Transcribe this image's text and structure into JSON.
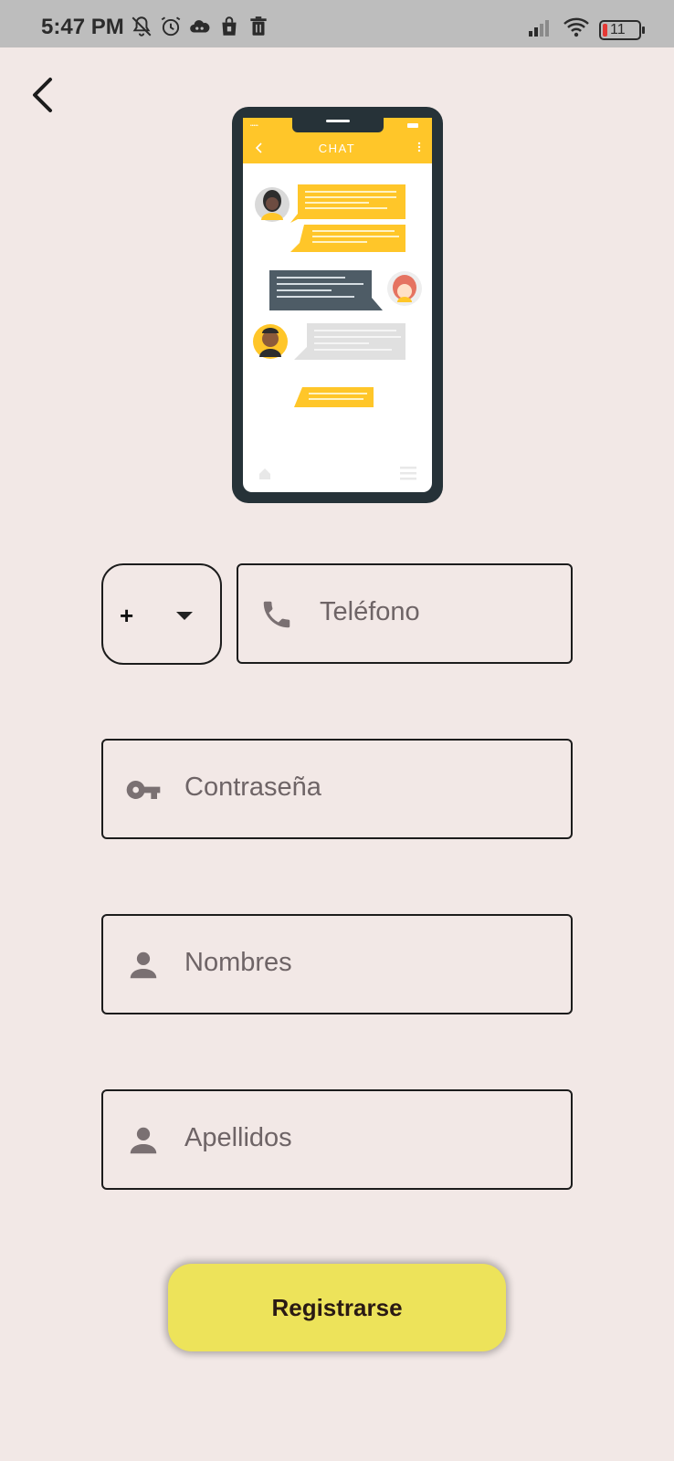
{
  "status_bar": {
    "time": "5:47 PM",
    "battery_level": "11",
    "icons_left": [
      "bell-off-icon",
      "alarm-icon",
      "cloud-icon",
      "shopping-bag-icon",
      "trash-icon"
    ],
    "icons_right": [
      "signal-icon",
      "wifi-icon",
      "battery-icon"
    ]
  },
  "nav": {
    "back_icon": "chevron-left-icon"
  },
  "illustration": {
    "header_title": "CHAT",
    "header_color": "#ffc629",
    "frame_color": "#263238"
  },
  "form": {
    "country_code": {
      "prefix": "+",
      "icon": "dropdown-arrow-icon"
    },
    "phone": {
      "placeholder": "Teléfono",
      "icon": "phone-icon"
    },
    "password": {
      "placeholder": "Contraseña",
      "icon": "key-icon"
    },
    "names": {
      "placeholder": "Nombres",
      "icon": "person-icon"
    },
    "lastnames": {
      "placeholder": "Apellidos",
      "icon": "person-icon"
    }
  },
  "register": {
    "label": "Registrarse",
    "color": "#ede35a"
  },
  "colors": {
    "background": "#f2e8e6",
    "placeholder_text": "#6e6466",
    "icon_gray": "#7a7072"
  }
}
